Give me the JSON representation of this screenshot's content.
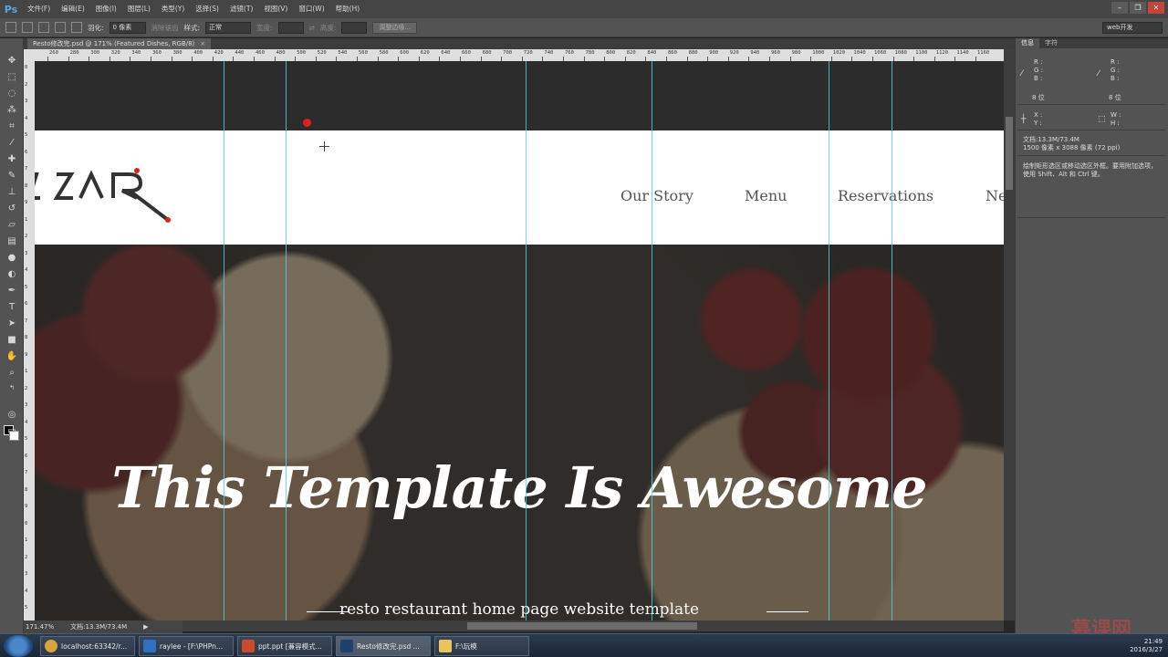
{
  "app": {
    "logo": "Ps",
    "menu": [
      "文件(F)",
      "编辑(E)",
      "图像(I)",
      "图层(L)",
      "类型(Y)",
      "选择(S)",
      "滤镜(T)",
      "视图(V)",
      "窗口(W)",
      "帮助(H)"
    ],
    "window_controls": [
      "–",
      "❐",
      "✕"
    ]
  },
  "options": {
    "feather_label": "羽化:",
    "feather_value": "0 像素",
    "antialias_label": "消除锯齿",
    "style_label": "样式:",
    "style_value": "正常",
    "width_label": "宽度:",
    "height_label": "高度:",
    "refine_button": "调整边缘...",
    "workspace": "web开发"
  },
  "document": {
    "tab_title": "Resto修改完.psd @ 171% (Featured Dishes, RGB/8)",
    "tab_close": "×"
  },
  "ruler": {
    "h_ticks": [
      "260",
      "280",
      "300",
      "320",
      "340",
      "360",
      "380",
      "400",
      "420",
      "440",
      "460",
      "480",
      "500",
      "520",
      "540",
      "560",
      "580",
      "600",
      "620",
      "640",
      "660",
      "680",
      "700",
      "720",
      "740",
      "760",
      "780",
      "800",
      "820",
      "840",
      "860",
      "880",
      "900",
      "920",
      "940",
      "960",
      "980",
      "1000",
      "1020",
      "1040",
      "1060",
      "1080",
      "1100",
      "1120",
      "1140",
      "1160"
    ],
    "v_ticks": [
      "0",
      "2",
      "3",
      "4",
      "5",
      "6",
      "7",
      "8",
      "9",
      "1",
      "2",
      "3",
      "4",
      "5",
      "6",
      "7",
      "8",
      "9",
      "1",
      "2",
      "3",
      "4",
      "5",
      "6",
      "7",
      "8",
      "9",
      "0",
      "1",
      "2",
      "3",
      "4",
      "5"
    ]
  },
  "site": {
    "logo_text": "ZAR",
    "nav": [
      "Our Story",
      "Menu",
      "Reservations",
      "Ne"
    ],
    "hero_title": "This Template Is Awesome",
    "hero_subtitle": "resto restaurant home page website template"
  },
  "status": {
    "zoom": "171.47%",
    "doc_size": "文档:13.3M/73.4M",
    "arrow": "▶"
  },
  "panel": {
    "tabs": [
      "信息",
      "字符"
    ],
    "r_label": "R :",
    "g_label": "G :",
    "b_label": "B :",
    "bit_depth": "8 位",
    "x_label": "X :",
    "y_label": "Y :",
    "w_label": "W :",
    "h_label": "H :",
    "doc_info": "文档:13.3M/73.4M",
    "dimensions": "1500 像素 x 3088 像素 (72 ppi)",
    "help_text": "绘制矩形选区或移动选区外框。要用附加选项，使用 Shift、Alt 和 Ctrl 键。"
  },
  "taskbar": {
    "tasks": [
      {
        "label": "localhost:63342/r...",
        "color": "#d9a43a"
      },
      {
        "label": "raylee - [F:\\PHPn...",
        "color": "#2f6fc4"
      },
      {
        "label": "ppt.ppt [兼容模式...",
        "color": "#c84b2c"
      },
      {
        "label": "Resto修改完.psd ...",
        "color": "#1f3f6e"
      },
      {
        "label": "F:\\玩模",
        "color": "#e8c45a"
      }
    ],
    "time": "21:49",
    "date": "2016/3/27"
  },
  "watermark": "慕课网",
  "colors": {
    "guide": "#4fd3e8",
    "logo_accent": "#e02020",
    "photoshop_blue": "#5aa4e6"
  }
}
